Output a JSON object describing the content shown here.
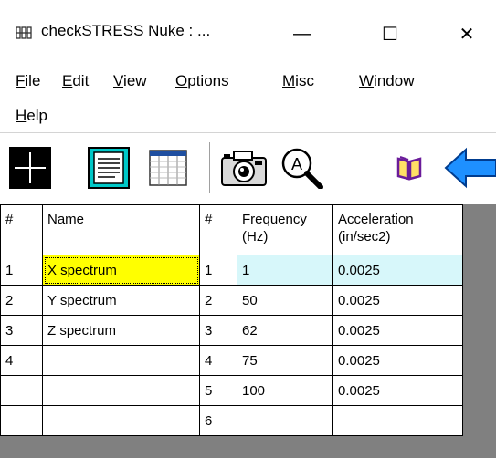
{
  "window": {
    "title": "checkSTRESS Nuke : ...",
    "minimize": "—",
    "maximize": "☐",
    "close": "✕"
  },
  "menu": {
    "items": [
      {
        "label": "File",
        "accel": "F",
        "rest": "ile"
      },
      {
        "label": "Edit",
        "accel": "E",
        "rest": "dit"
      },
      {
        "label": "View",
        "accel": "V",
        "rest": "iew"
      },
      {
        "label": "Options",
        "accel": "O",
        "rest": "ptions"
      },
      {
        "label": "Misc",
        "accel": "M",
        "rest": "isc"
      },
      {
        "label": "Window",
        "accel": "W",
        "rest": "indow"
      },
      {
        "label": "Help",
        "accel": "H",
        "rest": "elp"
      }
    ]
  },
  "toolbar": {
    "buttons": [
      {
        "icon": "crosshair-grid-icon"
      },
      {
        "icon": "document-text-icon"
      },
      {
        "icon": "table-list-icon"
      },
      {
        "icon": "camera-icon"
      },
      {
        "icon": "magnifier-a-icon"
      },
      {
        "icon": "book-icon"
      },
      {
        "icon": "arrow-left-icon"
      }
    ]
  },
  "grid": {
    "headers": {
      "num1": "#",
      "name": "Name",
      "num2": "#",
      "freq_line1": "Frequency",
      "freq_line2": "(Hz)",
      "acc_line1": "Acceleration",
      "acc_line2": "(in/sec2)"
    },
    "rows": [
      {
        "num1": "1",
        "name": "X spectrum",
        "num2": "1",
        "freq": "1",
        "acc": "0.0025"
      },
      {
        "num1": "2",
        "name": "Y spectrum",
        "num2": "2",
        "freq": "50",
        "acc": "0.0025"
      },
      {
        "num1": "3",
        "name": "Z spectrum",
        "num2": "3",
        "freq": "62",
        "acc": "0.0025"
      },
      {
        "num1": "4",
        "name": "",
        "num2": "4",
        "freq": "75",
        "acc": "0.0025"
      },
      {
        "num1": "",
        "name": "",
        "num2": "5",
        "freq": "100",
        "acc": "0.0025"
      },
      {
        "num1": "",
        "name": "",
        "num2": "6",
        "freq": "",
        "acc": ""
      }
    ]
  },
  "colors": {
    "selected_name_cell": "#ffff00",
    "selected_row_highlight": "#d7f7fa",
    "grid_background": "#808080",
    "arrow_blue": "#1e90ff"
  }
}
